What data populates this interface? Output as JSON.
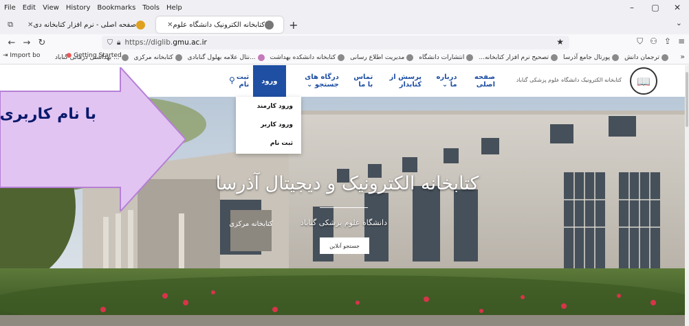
{
  "menubar": {
    "items": [
      "File",
      "Edit",
      "View",
      "History",
      "Bookmarks",
      "Tools",
      "Help"
    ]
  },
  "window_controls": {
    "minimize": "–",
    "maximize": "▢",
    "close": "✕"
  },
  "tabs": [
    {
      "title": "صفحه اصلی - نرم افزار کتابخانه دی",
      "close": "✕",
      "active": false
    },
    {
      "title": "کتابخانه الکترونیک دانشگاه علوم",
      "close": "✕",
      "active": true
    }
  ],
  "newtab_label": "+",
  "list_all_tabs": "⌄",
  "navbar": {
    "back": "←",
    "forward": "→",
    "reload": "↻",
    "url_prefix": "https://diglib.",
    "url_domain": "gmu.ac.ir",
    "right_icons": [
      "⛉",
      "⚇",
      "⇪",
      "≡"
    ]
  },
  "bookmarks": {
    "left": [
      "Import bo",
      "Getting Started"
    ],
    "items": [
      "ترجمان دانش",
      "پورتال جامع آذرسا",
      "تصحیح نرم افزار کتابخانه...",
      "انتشارات دانشگاه",
      "مدیریت اطلاع رسانی",
      "کتابخانه دانشکده بهداشت",
      "...نتال علامه بهلول گنابادی",
      "کتابخانه مرکزی",
      "... بهداشتی درمانی گناباد"
    ],
    "more": "»"
  },
  "site": {
    "name": "کتابخانه الکترونیک دانشگاه علوم پزشکی گناباد",
    "logo_glyph": "📖",
    "nav": [
      {
        "label": "صفحه اصلی",
        "active": false
      },
      {
        "label": "درباره ما ⌄",
        "active": false
      },
      {
        "label": "پرسش از کتابدار",
        "active": false
      },
      {
        "label": "تماس با ما",
        "active": false
      },
      {
        "label": "درگاه های جستجو ⌄",
        "active": false
      },
      {
        "label": "ورود",
        "active": true
      },
      {
        "label": "ثبت نام",
        "active": false
      }
    ],
    "search_icon": "⚲"
  },
  "dropdown": {
    "items": [
      "ورود کارمند",
      "ورود کاربر",
      "ثبت نام"
    ]
  },
  "hero": {
    "title": "کتابخانه الکترونیک و دیجیتال آذرسا",
    "subtitle": "دانشگاه علوم پزشکی گناباد",
    "button": "جستجو آنلاین",
    "building_sign": "کتابخانه مرکزی"
  },
  "callout": {
    "text": "با نام کاربری"
  },
  "colors": {
    "accent": "#1e4fa3",
    "callout_fill": "#e2c4f2",
    "callout_stroke": "#b57fd6"
  }
}
